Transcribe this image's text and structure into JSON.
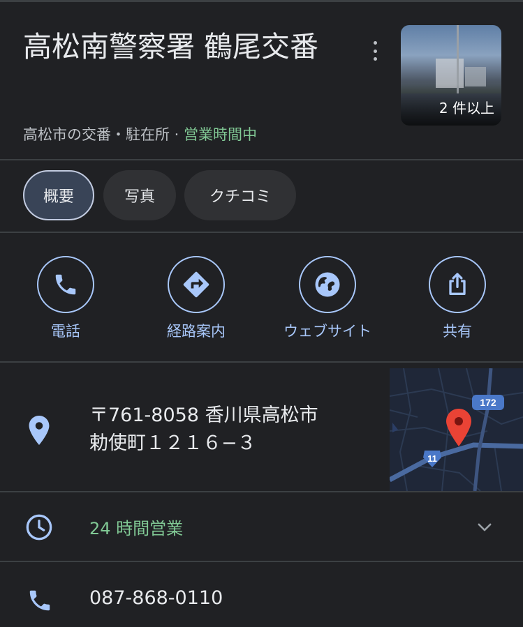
{
  "place": {
    "title": "高松南警察署 鶴尾交番",
    "category": "高松市の交番・駐在所",
    "separator": " · ",
    "open_status": "営業時間中",
    "photo_count": "2 件以上"
  },
  "tabs": [
    {
      "label": "概要",
      "active": true
    },
    {
      "label": "写真",
      "active": false
    },
    {
      "label": "クチコミ",
      "active": false
    }
  ],
  "actions": [
    {
      "label": "電話",
      "icon": "phone-icon"
    },
    {
      "label": "経路案内",
      "icon": "directions-icon"
    },
    {
      "label": "ウェブサイト",
      "icon": "globe-icon"
    },
    {
      "label": "共有",
      "icon": "share-icon"
    }
  ],
  "address": {
    "line1": "〒761-8058 香川県高松市",
    "line2": "勅使町１２１６−３"
  },
  "map": {
    "route_badge_1": "172",
    "route_badge_2": "11"
  },
  "hours": {
    "text": "24 時間営業"
  },
  "phone": {
    "number": "087-868-0110"
  },
  "colors": {
    "background": "#202124",
    "accent": "#a8c7fa",
    "open_green": "#81c995",
    "marker_red": "#ea4335"
  }
}
